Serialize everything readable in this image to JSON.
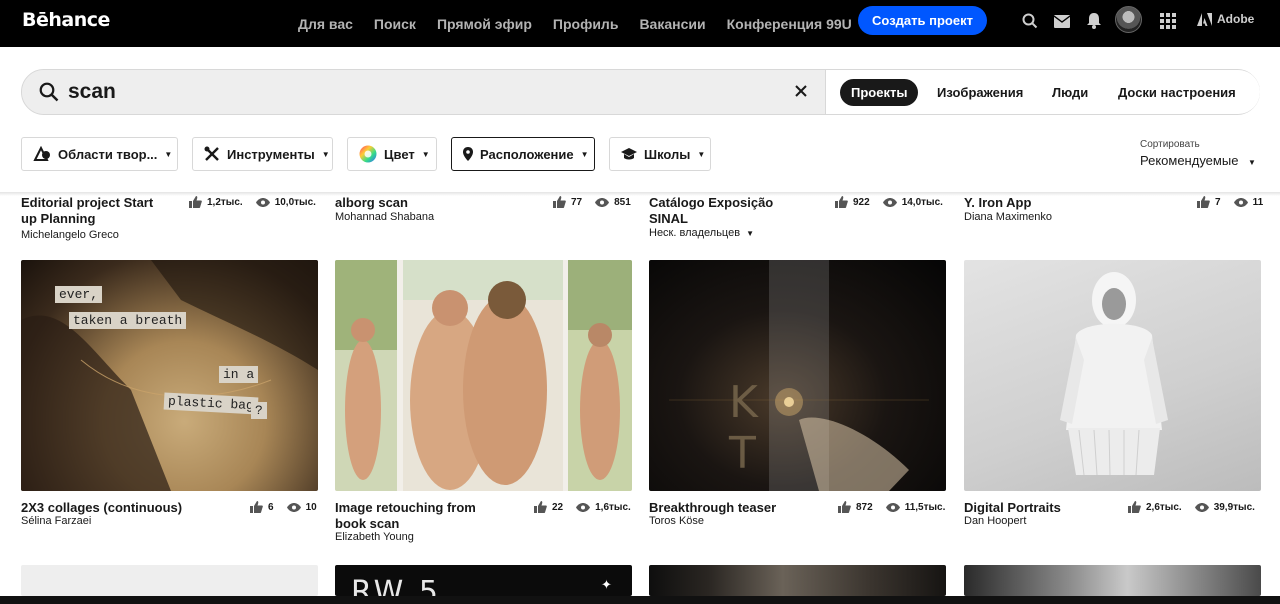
{
  "nav": {
    "logo": "Bēhance",
    "links": [
      "Для вас",
      "Поиск",
      "Прямой эфир",
      "Профиль",
      "Вакансии",
      "Конференция 99U"
    ],
    "create_button": "Создать проект",
    "adobe_label": "Adobe"
  },
  "search": {
    "query": "scan",
    "tabs": [
      "Проекты",
      "Изображения",
      "Люди",
      "Доски настроения"
    ],
    "active_tab": "Проекты"
  },
  "filters": {
    "creative_fields": "Области твор...",
    "tools": "Инструменты",
    "color": "Цвет",
    "location": "Расположение",
    "schools": "Школы"
  },
  "sort": {
    "label": "Сортировать",
    "value": "Рекомендуемые"
  },
  "row1": [
    {
      "title_line1": "Editorial project Start",
      "title_line2": "up Planning",
      "owner": "Michelangelo Greco",
      "likes": "1,2тыс.",
      "views": "10,0тыс."
    },
    {
      "title_line1": "alborg scan",
      "title_line2": "",
      "owner": "Mohannad Shabana",
      "likes": "77",
      "views": "851"
    },
    {
      "title_line1": "Catálogo Exposição",
      "title_line2": "SINAL",
      "owner": "Неск. владельцев",
      "likes": "922",
      "views": "14,0тыс."
    },
    {
      "title_line1": "Y. Iron App",
      "title_line2": "",
      "owner": "Diana Maximenko",
      "likes": "7",
      "views": "11"
    }
  ],
  "row2": [
    {
      "title_line1": "2X3 collages (continuous)",
      "title_line2": "",
      "owner": "Sélina Farzaei",
      "likes": "6",
      "views": "10",
      "collage_words": [
        "ever,",
        "taken a breath",
        "in a",
        "plastic bag",
        "?"
      ]
    },
    {
      "title_line1": "Image retouching from",
      "title_line2": "book scan",
      "owner": "Elizabeth Young",
      "likes": "22",
      "views": "1,6тыс."
    },
    {
      "title_line1": "Breakthrough teaser",
      "title_line2": "",
      "owner": "Toros Köse",
      "likes": "872",
      "views": "11,5тыс.",
      "overlay_letters": "K T"
    },
    {
      "title_line1": "Digital Portraits",
      "title_line2": "",
      "owner": "Dan Hoopert",
      "likes": "2,6тыс.",
      "views": "39,9тыс."
    }
  ],
  "row3_partial_text": "RW 5",
  "colors": {
    "nav_bg": "#000000",
    "accent_blue": "#0057ff",
    "text": "#191919"
  }
}
